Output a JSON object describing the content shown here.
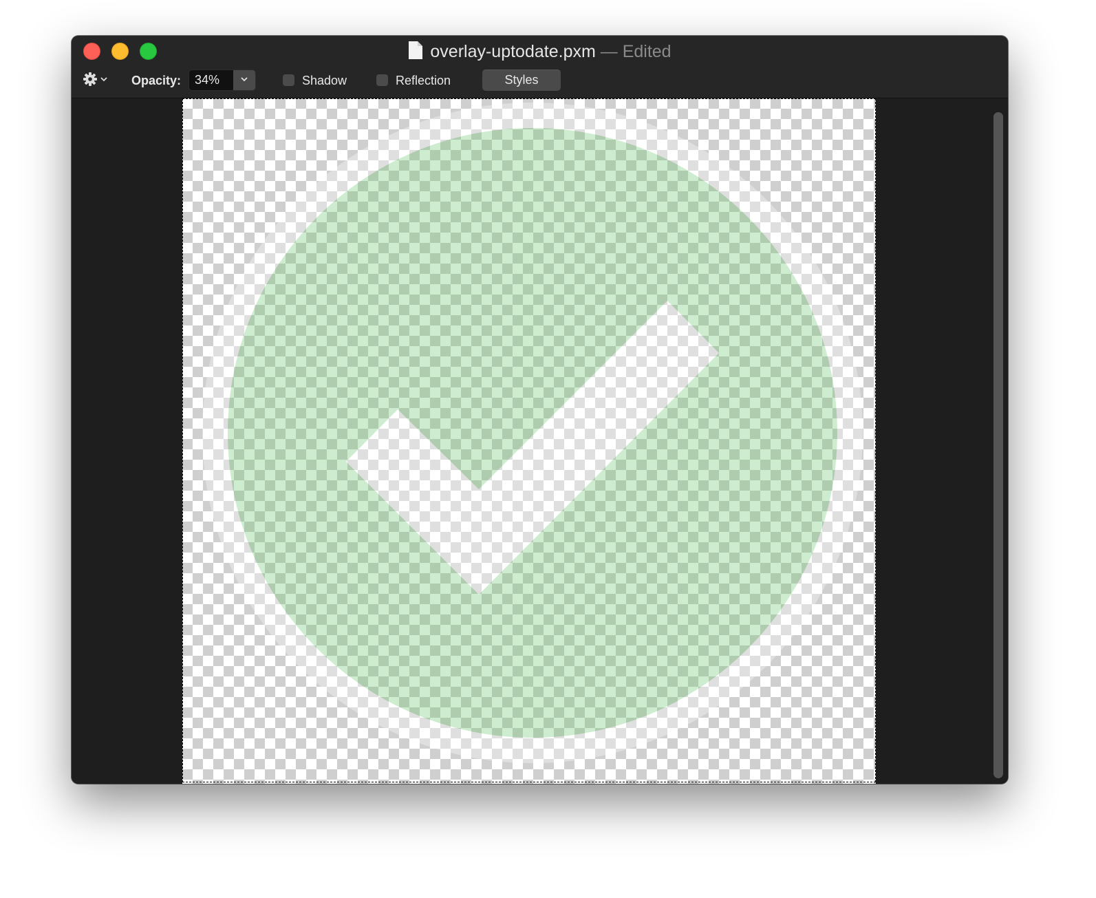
{
  "window": {
    "filename": "overlay-uptodate.pxm",
    "separator": "—",
    "status": "Edited"
  },
  "toolbar": {
    "gear_icon": "gear-icon",
    "opacity_label": "Opacity:",
    "opacity_value": "34%",
    "shadow_label": "Shadow",
    "shadow_checked": false,
    "reflection_label": "Reflection",
    "reflection_checked": false,
    "styles_label": "Styles"
  },
  "canvas": {
    "background": "transparency-checkerboard",
    "image": "green-circle-checkmark",
    "circle_color": "#72c874",
    "ring_color": "#ffffff",
    "checkmark_color": "#ffffff",
    "opacity": 0.34
  },
  "colors": {
    "window_bg": "#1e1e1e",
    "close": "#fe5f57",
    "minimize": "#febc2e",
    "zoom": "#28c840"
  }
}
